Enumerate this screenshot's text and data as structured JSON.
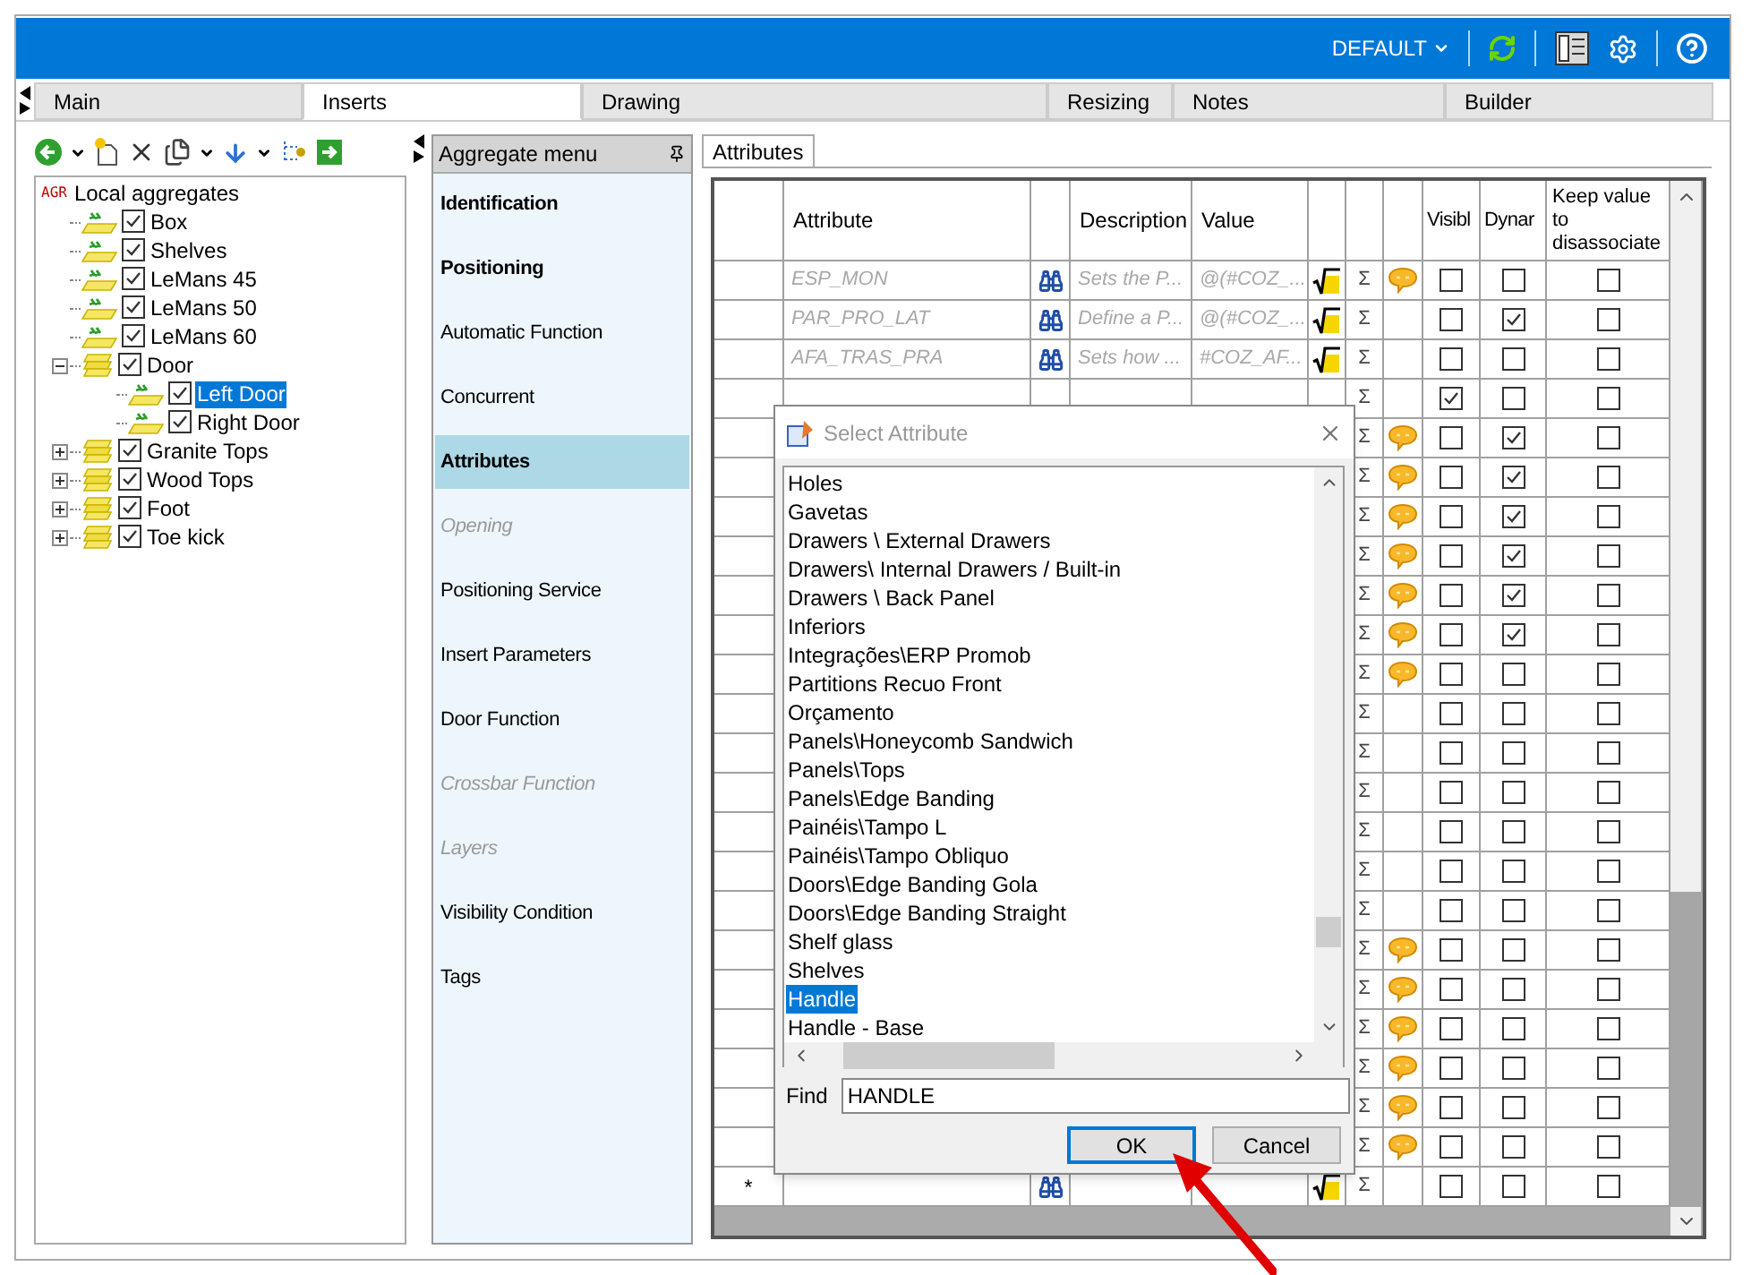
{
  "header": {
    "profile": "DEFAULT"
  },
  "tabs": [
    {
      "label": "Main",
      "selected": false
    },
    {
      "label": "Inserts",
      "selected": true
    },
    {
      "label": "Drawing",
      "selected": false
    },
    {
      "label": "Resizing",
      "selected": false
    },
    {
      "label": "Notes",
      "selected": false
    },
    {
      "label": "Builder",
      "selected": false
    }
  ],
  "tree": {
    "badge": "AGR",
    "label": "Local aggregates",
    "items": [
      {
        "label": "Box",
        "kind": "item",
        "checked": true,
        "selected": false
      },
      {
        "label": "Shelves",
        "kind": "item",
        "checked": true,
        "selected": false
      },
      {
        "label": "LeMans 45",
        "kind": "item",
        "checked": true,
        "selected": false
      },
      {
        "label": "LeMans 50",
        "kind": "item",
        "checked": true,
        "selected": false
      },
      {
        "label": "LeMans 60",
        "kind": "item",
        "checked": true,
        "selected": false
      },
      {
        "label": "Door",
        "kind": "group",
        "checked": true,
        "selected": false,
        "expanded": true,
        "children": [
          {
            "label": "Left Door",
            "kind": "item",
            "checked": true,
            "selected": true
          },
          {
            "label": "Right Door",
            "kind": "item",
            "checked": true,
            "selected": false
          }
        ]
      },
      {
        "label": "Granite Tops",
        "kind": "group",
        "checked": true,
        "selected": false,
        "expanded": false
      },
      {
        "label": "Wood Tops",
        "kind": "group",
        "checked": true,
        "selected": false,
        "expanded": false
      },
      {
        "label": "Foot",
        "kind": "group",
        "checked": true,
        "selected": false,
        "expanded": false
      },
      {
        "label": "Toe kick",
        "kind": "group",
        "checked": true,
        "selected": false,
        "expanded": false
      }
    ]
  },
  "aggregate_menu": {
    "title": "Aggregate menu",
    "items": [
      {
        "label": "Identification",
        "bold": true,
        "disabled": false,
        "selected": false
      },
      {
        "label": "Positioning",
        "bold": true,
        "disabled": false,
        "selected": false
      },
      {
        "label": "Automatic Function",
        "bold": false,
        "disabled": false,
        "selected": false
      },
      {
        "label": "Concurrent",
        "bold": false,
        "disabled": false,
        "selected": false
      },
      {
        "label": "Attributes",
        "bold": true,
        "disabled": false,
        "selected": true
      },
      {
        "label": "Opening",
        "bold": false,
        "disabled": true,
        "selected": false
      },
      {
        "label": "Positioning Service",
        "bold": false,
        "disabled": false,
        "selected": false
      },
      {
        "label": "Insert Parameters",
        "bold": false,
        "disabled": false,
        "selected": false
      },
      {
        "label": "Door Function",
        "bold": false,
        "disabled": false,
        "selected": false
      },
      {
        "label": "Crossbar Function",
        "bold": false,
        "disabled": true,
        "selected": false
      },
      {
        "label": "Layers",
        "bold": false,
        "disabled": true,
        "selected": false
      },
      {
        "label": "Visibility Condition",
        "bold": false,
        "disabled": false,
        "selected": false
      },
      {
        "label": "Tags",
        "bold": false,
        "disabled": false,
        "selected": false
      }
    ]
  },
  "attributes_tab": {
    "label": "Attributes"
  },
  "table": {
    "columns": {
      "attribute": "Attribute",
      "description": "Description",
      "value": "Value",
      "visible": "Visibl",
      "dynamic": "Dynar",
      "keep": "Keep value to disassociate"
    },
    "rows": [
      {
        "kind": "data",
        "attribute": "ESP_MON",
        "description": "Sets the P...",
        "value": "@(#COZ_...",
        "sum": "Σ",
        "comment": true,
        "visible": false,
        "dynamic": false,
        "keep": false
      },
      {
        "kind": "data",
        "attribute": "PAR_PRO_LAT",
        "description": "Define a P...",
        "value": "@(#COZ_...",
        "sum": "Σ",
        "comment": false,
        "visible": false,
        "dynamic": true,
        "keep": false
      },
      {
        "kind": "data",
        "attribute": "AFA_TRAS_PRA",
        "description": "Sets how ...",
        "value": "#COZ_AF...",
        "sum": "Σ",
        "comment": false,
        "visible": false,
        "dynamic": false,
        "keep": false
      },
      {
        "kind": "blank",
        "sum": "Σ",
        "comment": false,
        "visible": true,
        "dynamic": false,
        "keep": false
      },
      {
        "kind": "hidden",
        "sum": "Σ",
        "comment": true,
        "visible": false,
        "dynamic": true,
        "keep": false
      },
      {
        "kind": "hidden",
        "sum": "Σ",
        "comment": true,
        "visible": false,
        "dynamic": true,
        "keep": false
      },
      {
        "kind": "hidden",
        "sum": "Σ",
        "comment": true,
        "visible": false,
        "dynamic": true,
        "keep": false
      },
      {
        "kind": "hidden",
        "sum": "Σ",
        "comment": true,
        "visible": false,
        "dynamic": true,
        "keep": false
      },
      {
        "kind": "hidden",
        "sum": "Σ",
        "comment": true,
        "visible": false,
        "dynamic": true,
        "keep": false
      },
      {
        "kind": "hidden",
        "sum": "Σ",
        "comment": true,
        "visible": false,
        "dynamic": true,
        "keep": false
      },
      {
        "kind": "hidden",
        "sum": "Σ",
        "comment": true,
        "visible": false,
        "dynamic": false,
        "keep": false
      },
      {
        "kind": "hidden",
        "sum": "Σ",
        "comment": false,
        "visible": false,
        "dynamic": false,
        "keep": false
      },
      {
        "kind": "hidden",
        "sum": "Σ",
        "comment": false,
        "visible": false,
        "dynamic": false,
        "keep": false
      },
      {
        "kind": "hidden",
        "sum": "Σ",
        "comment": false,
        "visible": false,
        "dynamic": false,
        "keep": false
      },
      {
        "kind": "hidden",
        "sum": "Σ",
        "comment": false,
        "visible": false,
        "dynamic": false,
        "keep": false
      },
      {
        "kind": "hidden",
        "sum": "Σ",
        "comment": false,
        "visible": false,
        "dynamic": false,
        "keep": false
      },
      {
        "kind": "hidden",
        "sum": "Σ",
        "comment": false,
        "visible": false,
        "dynamic": false,
        "keep": false
      },
      {
        "kind": "hidden",
        "sum": "Σ",
        "comment": true,
        "visible": false,
        "dynamic": false,
        "keep": false
      },
      {
        "kind": "hidden",
        "sum": "Σ",
        "comment": true,
        "visible": false,
        "dynamic": false,
        "keep": false
      },
      {
        "kind": "hidden",
        "sum": "Σ",
        "comment": true,
        "visible": false,
        "dynamic": false,
        "keep": false
      },
      {
        "kind": "hidden",
        "sum": "Σ",
        "comment": true,
        "visible": false,
        "dynamic": false,
        "keep": false
      },
      {
        "kind": "hidden",
        "sum": "Σ",
        "comment": true,
        "visible": false,
        "dynamic": false,
        "keep": false
      },
      {
        "kind": "hidden",
        "sum": "Σ",
        "comment": true,
        "visible": false,
        "dynamic": false,
        "keep": false
      },
      {
        "kind": "new",
        "marker": "*",
        "sum": "Σ",
        "comment": false,
        "visible": false,
        "dynamic": false,
        "keep": false
      }
    ]
  },
  "dialog": {
    "title": "Select Attribute",
    "items": [
      {
        "label": "Holes",
        "selected": false
      },
      {
        "label": "Gavetas",
        "selected": false
      },
      {
        "label": "Drawers \\ External Drawers",
        "selected": false
      },
      {
        "label": "Drawers\\ Internal Drawers / Built-in",
        "selected": false
      },
      {
        "label": "Drawers \\ Back Panel",
        "selected": false
      },
      {
        "label": "Inferiors",
        "selected": false
      },
      {
        "label": "Integrações\\ERP Promob",
        "selected": false
      },
      {
        "label": "Partitions Recuo Front",
        "selected": false
      },
      {
        "label": "Orçamento",
        "selected": false
      },
      {
        "label": "Panels\\Honeycomb Sandwich",
        "selected": false
      },
      {
        "label": "Panels\\Tops",
        "selected": false
      },
      {
        "label": "Panels\\Edge Banding",
        "selected": false
      },
      {
        "label": "Painéis\\Tampo L",
        "selected": false
      },
      {
        "label": "Painéis\\Tampo Obliquo",
        "selected": false
      },
      {
        "label": "Doors\\Edge Banding Gola",
        "selected": false
      },
      {
        "label": "Doors\\Edge Banding Straight",
        "selected": false
      },
      {
        "label": "Shelf glass",
        "selected": false
      },
      {
        "label": "Shelves",
        "selected": false
      },
      {
        "label": "Handle",
        "selected": true
      },
      {
        "label": "Handle - Base",
        "selected": false
      }
    ],
    "find_label": "Find",
    "find_value": "HANDLE",
    "buttons": [
      {
        "label": "OK",
        "default": true
      },
      {
        "label": "Cancel",
        "default": false
      }
    ]
  }
}
